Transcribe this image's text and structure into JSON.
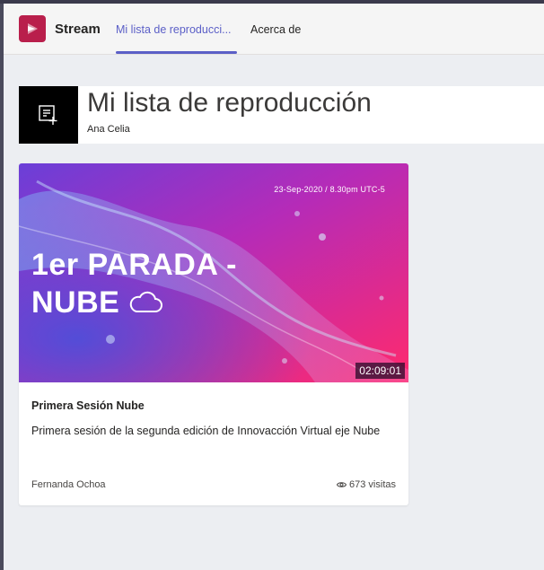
{
  "app": {
    "name": "Stream",
    "logo_color": "#b91f4c"
  },
  "tabs": [
    {
      "label": "Mi lista de reproducci...",
      "active": true
    },
    {
      "label": "Acerca de",
      "active": false
    }
  ],
  "accent_color": "#5b5fc7",
  "playlist": {
    "title": "Mi lista de reproducción",
    "owner": "Ana Celia",
    "icon": "add-to-playlist-icon"
  },
  "videos": [
    {
      "thumbnail": {
        "date_text": "23-Sep-2020 / 8.30pm UTC-5",
        "title_line1": "1er PARADA -",
        "title_line2": "NUBE",
        "icon": "cloud-icon"
      },
      "duration": "02:09:01",
      "title": "Primera Sesión Nube",
      "description": "Primera sesión de la segunda edición de Innovacción Virtual eje Nube",
      "author": "Fernanda Ochoa",
      "views": "673 visitas",
      "views_icon": "eye-icon"
    }
  ]
}
